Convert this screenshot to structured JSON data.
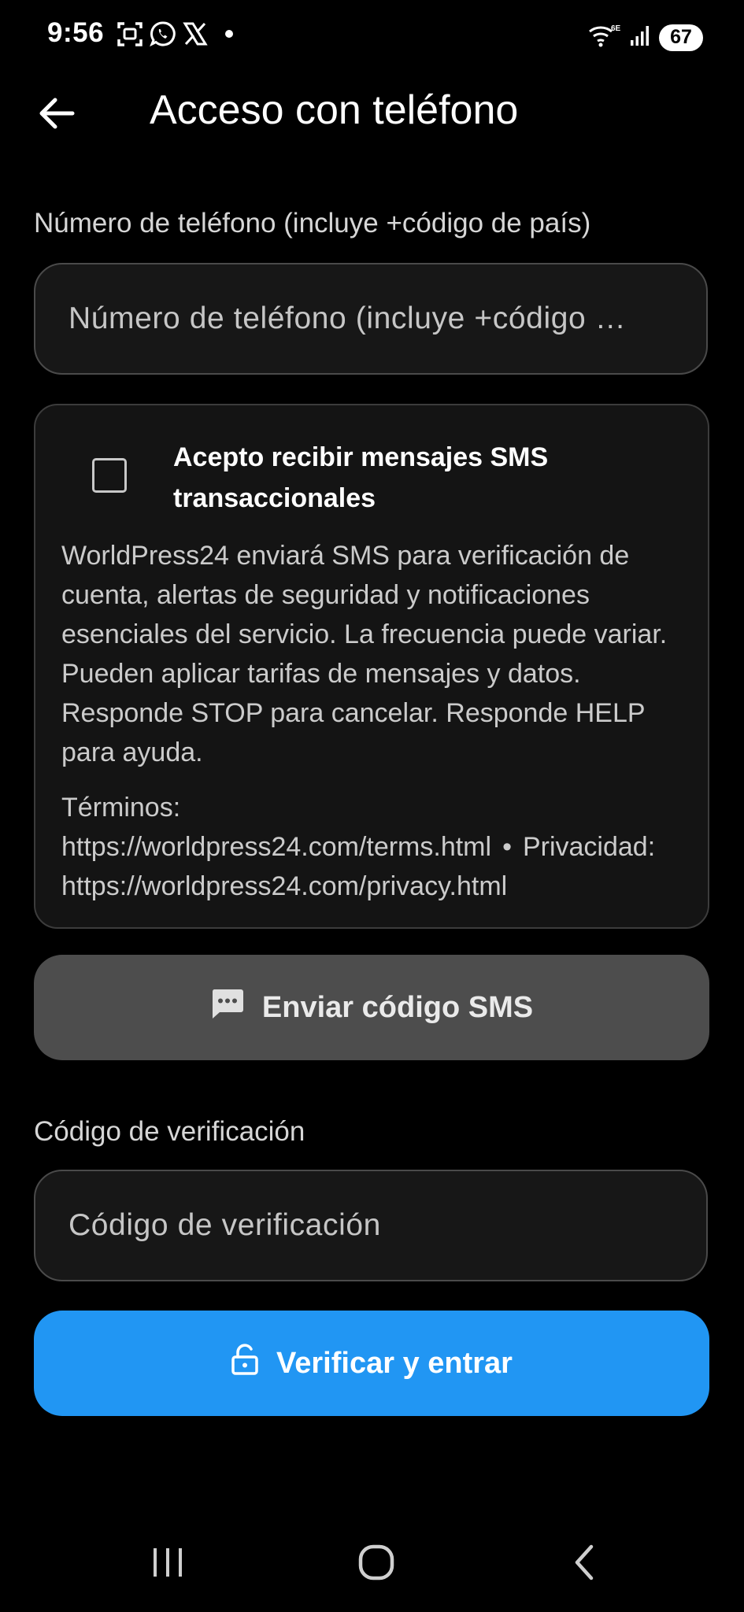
{
  "status_bar": {
    "time": "9:56",
    "battery": "67",
    "icons_left": [
      "screenshot-icon",
      "whatsapp-icon",
      "x-icon",
      "dot-icon"
    ],
    "icons_right": [
      "wifi-6e-icon",
      "signal-icon",
      "battery-icon"
    ]
  },
  "app_bar": {
    "title": "Acceso con teléfono",
    "back_icon": "arrow-left-icon"
  },
  "phone": {
    "label": "Número de teléfono (incluye +código de país)",
    "placeholder": "Número de teléfono (incluye +código …",
    "value": ""
  },
  "consent": {
    "checked": false,
    "title": "Acepto recibir mensajes SMS transaccionales",
    "body": "WorldPress24 enviará SMS para verificación de cuenta, alertas de seguridad y notificaciones esenciales del servicio. La frecuencia puede variar. Pueden aplicar tarifas de mensajes y datos. Responde STOP para cancelar. Responde HELP para ayuda.",
    "terms_text": "Términos: https://worldpress24.com/terms.html",
    "separator": "•",
    "privacy_text": "Privacidad: https://worldpress24.com/privacy.html"
  },
  "send_sms_button": {
    "label": "Enviar código SMS",
    "icon": "sms-icon"
  },
  "verification": {
    "label": "Código de verificación",
    "placeholder": "Código de verificación",
    "value": ""
  },
  "verify_button": {
    "label": "Verificar y entrar",
    "icon": "lock-icon"
  },
  "colors": {
    "background": "#000000",
    "primary": "#2196f3",
    "disabled_button": "#4d4d4d",
    "field_background": "#171717"
  },
  "nav_bar": {
    "icons": [
      "recent-apps-icon",
      "home-icon",
      "back-icon"
    ]
  }
}
